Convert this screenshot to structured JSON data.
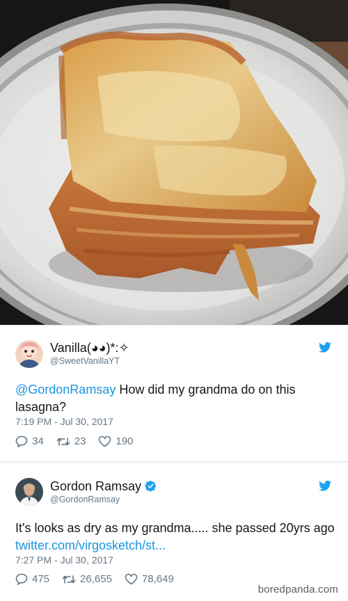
{
  "tweet1": {
    "name": "Vanilla(◕◕)*:✧",
    "handle": "@SweetVanillaYT",
    "mention": "@GordonRamsay",
    "text_rest": " How did my grandma do on this lasagna?",
    "timestamp": "7:19 PM - Jul 30, 2017",
    "replies": "34",
    "retweets": "23",
    "likes": "190"
  },
  "tweet2": {
    "name": "Gordon Ramsay",
    "handle": "@GordonRamsay",
    "text_main": "It's looks as dry as my grandma..... she passed 20yrs ago ",
    "link": "twitter.com/virgosketch/st...",
    "timestamp": "7:27 PM - Jul 30, 2017",
    "replies": "475",
    "retweets": "26,655",
    "likes": "78,649"
  },
  "watermark": "boredpanda.com",
  "colors": {
    "twitter_blue": "#1da1f2",
    "link_blue": "#1b95e0",
    "muted_text": "#657786"
  },
  "icons": [
    "twitter-bird-icon",
    "verified-badge-icon",
    "reply-icon",
    "retweet-icon",
    "like-icon"
  ]
}
